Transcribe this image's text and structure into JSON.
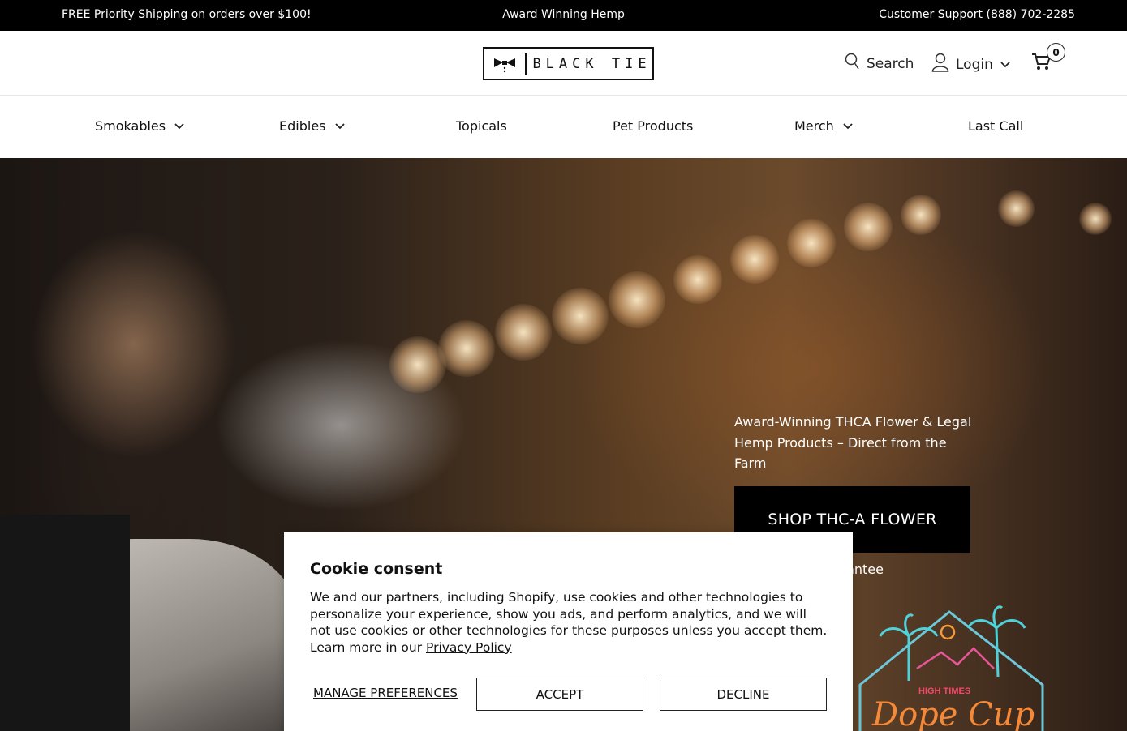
{
  "announcement": {
    "left": "FREE Priority Shipping on orders over $100!",
    "center": "Award Winning Hemp",
    "right": "Customer Support (888) 702-2285"
  },
  "header": {
    "logo_text": "BLACK TIE",
    "search_label": "Search",
    "login_label": "Login",
    "cart_count": "0",
    "icons": {
      "search": "search-icon",
      "user": "user-icon",
      "cart": "cart-icon",
      "logo": "bowtie-icon"
    }
  },
  "nav": {
    "items": [
      {
        "label": "Smokables",
        "dropdown": true
      },
      {
        "label": "Edibles",
        "dropdown": true
      },
      {
        "label": "Topicals",
        "dropdown": false
      },
      {
        "label": "Pet Products",
        "dropdown": false
      },
      {
        "label": "Merch",
        "dropdown": true
      },
      {
        "label": "Last Call",
        "dropdown": false
      }
    ]
  },
  "hero": {
    "headline": "Award-Winning THCA Flower & Legal Hemp Products – Direct from the Farm",
    "cta_label": "SHOP THC-A FLOWER",
    "guarantee_text": "ck Guarantee",
    "badge_top": "HIGH TIMES",
    "badge_title": "Dope Cup"
  },
  "cookie": {
    "title": "Cookie consent",
    "body": "We and our partners, including Shopify, use cookies and other technologies to personalize your experience, show you ads, and perform analytics, and we will not use cookies or other technologies for these purposes unless you accept them. Learn more in our ",
    "link_label": "Privacy Policy",
    "manage_label": "MANAGE PREFERENCES",
    "accept_label": "ACCEPT",
    "decline_label": "DECLINE"
  },
  "colors": {
    "bar_bg": "#000000",
    "cta_bg": "#000000",
    "text": "#111111"
  }
}
